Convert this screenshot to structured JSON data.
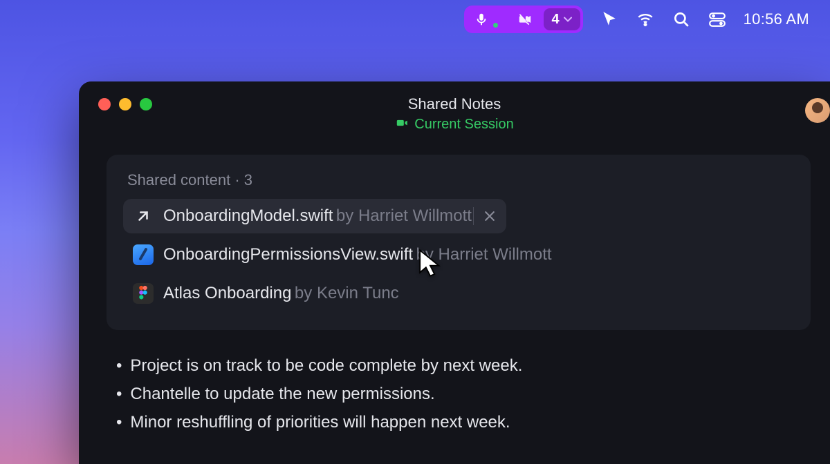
{
  "menubar": {
    "participants": "4",
    "time": "10:56 AM"
  },
  "window": {
    "title": "Shared Notes",
    "session_label": "Current Session"
  },
  "panel": {
    "label_prefix": "Shared content",
    "count": "3"
  },
  "content": {
    "by_word": "by",
    "items": [
      {
        "name": "OnboardingModel.swift",
        "author": "Harriet Willmott"
      },
      {
        "name": "OnboardingPermissionsView.swift",
        "author": "Harriet Willmott"
      },
      {
        "name": "Atlas Onboarding",
        "author": "Kevin Tunc"
      }
    ]
  },
  "notes": [
    "Project is on track to be code complete by next week.",
    "Chantelle to update the new permissions.",
    "Minor reshuffling of priorities will happen next week."
  ]
}
